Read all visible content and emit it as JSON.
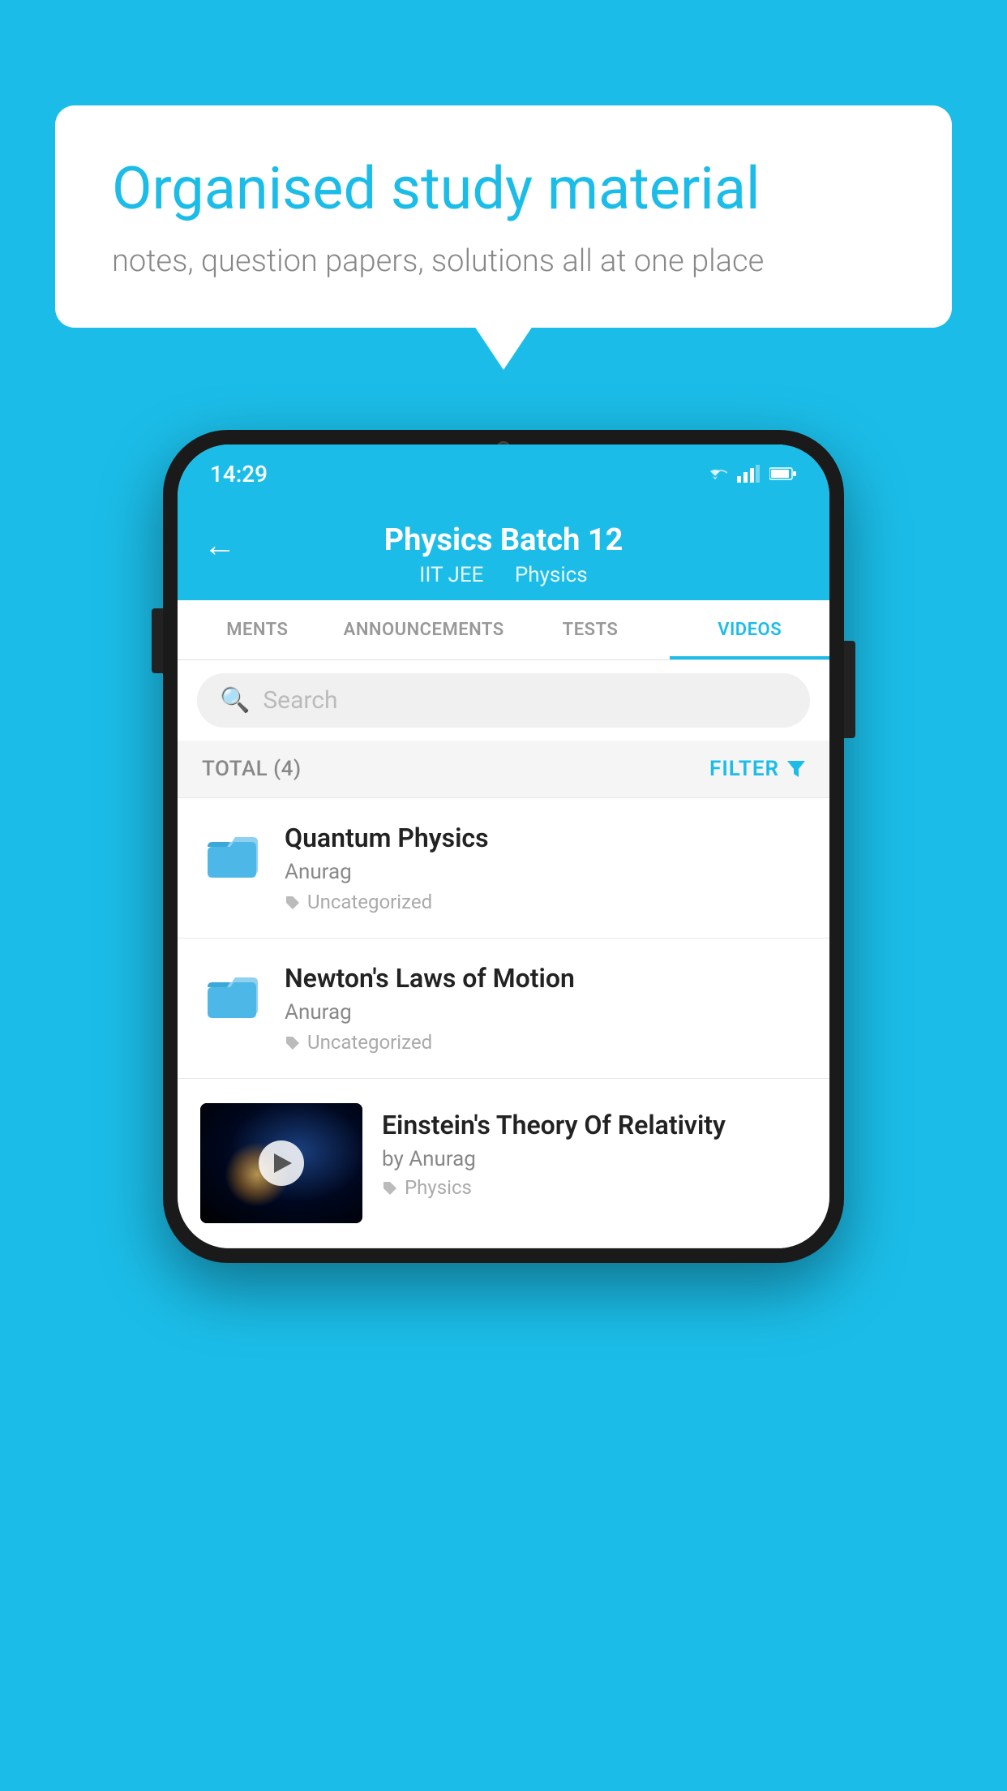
{
  "background_color": "#1bbde8",
  "speech_bubble": {
    "title": "Organised study material",
    "subtitle": "notes, question papers, solutions all at one place"
  },
  "phone": {
    "status_bar": {
      "time": "14:29",
      "icons": [
        "wifi",
        "signal",
        "battery"
      ]
    },
    "header": {
      "back_label": "←",
      "title": "Physics Batch 12",
      "subtitle_1": "IIT JEE",
      "subtitle_2": "Physics"
    },
    "tabs": [
      {
        "label": "MENTS",
        "active": false
      },
      {
        "label": "ANNOUNCEMENTS",
        "active": false
      },
      {
        "label": "TESTS",
        "active": false
      },
      {
        "label": "VIDEOS",
        "active": true
      }
    ],
    "search": {
      "placeholder": "Search"
    },
    "filter_bar": {
      "total_label": "TOTAL (4)",
      "filter_label": "FILTER"
    },
    "videos": [
      {
        "id": "quantum-physics",
        "title": "Quantum Physics",
        "author": "Anurag",
        "tag": "Uncategorized",
        "has_thumbnail": false
      },
      {
        "id": "newtons-laws",
        "title": "Newton's Laws of Motion",
        "author": "Anurag",
        "tag": "Uncategorized",
        "has_thumbnail": false
      },
      {
        "id": "einstein-relativity",
        "title": "Einstein's Theory Of Relativity",
        "author": "by Anurag",
        "tag": "Physics",
        "has_thumbnail": true
      }
    ]
  }
}
